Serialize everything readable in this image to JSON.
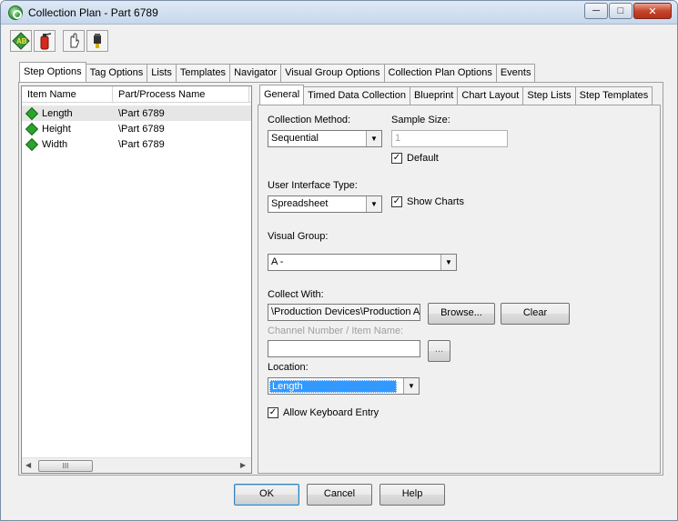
{
  "window": {
    "title": "Collection Plan - Part 6789"
  },
  "toolbar": {
    "icons": [
      "abc-icon",
      "fire-extinguisher-icon",
      "hand-icon",
      "pointer-icon"
    ]
  },
  "top_tabs": [
    "Step Options",
    "Tag Options",
    "Lists",
    "Templates",
    "Navigator",
    "Visual Group Options",
    "Collection Plan Options",
    "Events"
  ],
  "list": {
    "columns": [
      "Item Name",
      "Part/Process Name"
    ],
    "rows": [
      {
        "name": "Length",
        "part": "\\Part 6789"
      },
      {
        "name": "Height",
        "part": "\\Part 6789"
      },
      {
        "name": "Width",
        "part": "\\Part 6789"
      }
    ],
    "scroll_thumb": "III"
  },
  "inner_tabs": [
    "General",
    "Timed Data Collection",
    "Blueprint",
    "Chart Layout",
    "Step Lists",
    "Step Templates"
  ],
  "general": {
    "collection_method_label": "Collection Method:",
    "collection_method_value": "Sequential",
    "sample_size_label": "Sample Size:",
    "sample_size_value": "1",
    "default_label": "Default",
    "ui_type_label": "User Interface Type:",
    "ui_type_value": "Spreadsheet",
    "show_charts_label": "Show Charts",
    "visual_group_label": "Visual Group:",
    "visual_group_value": "A -",
    "collect_with_label": "Collect With:",
    "collect_with_value": "\\Production Devices\\Production A",
    "browse_label": "Browse...",
    "clear_label": "Clear",
    "channel_label": "Channel Number / Item Name:",
    "channel_value": "",
    "ellipsis_label": "...",
    "location_label": "Location:",
    "location_value": "Length",
    "allow_keyboard_label": "Allow Keyboard Entry"
  },
  "footer": {
    "ok_label": "OK",
    "cancel_label": "Cancel",
    "help_label": "Help"
  }
}
